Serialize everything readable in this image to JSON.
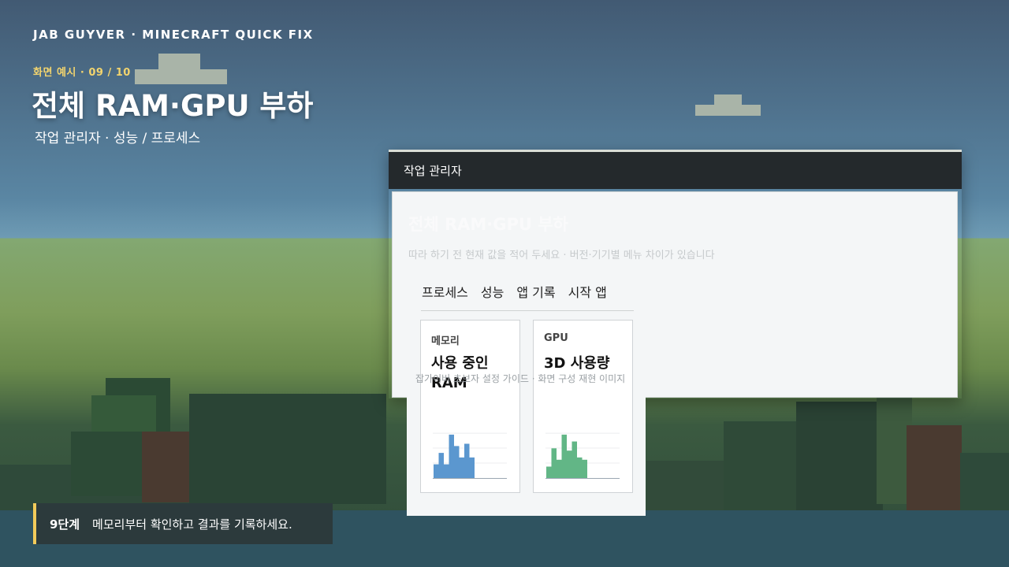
{
  "brand": "JAB GUYVER · MINECRAFT QUICK FIX",
  "kicker": "화면 예시 · 09 / 10",
  "headline": "전체 RAM·GPU 부하",
  "subline": "작업 관리자 · 성능 / 프로세스",
  "window": {
    "title": "작업 관리자",
    "ghost_title": "전체 RAM·GPU 부하",
    "note": "따라 하기 전 현재 값을 적어 두세요 · 버전·기기별 메뉴 차이가 있습니다",
    "tabs": [
      "프로세스",
      "성능",
      "앱 기록",
      "시작 앱"
    ]
  },
  "cards": [
    {
      "category": "메모리",
      "title": "사용 중인 RAM",
      "color": "#5b97cf",
      "values": [
        0.3,
        0.55,
        0.3,
        0.95,
        0.7,
        0.45,
        0.75,
        0.45
      ]
    },
    {
      "category": "GPU",
      "title": "3D 사용량",
      "color": "#62b686",
      "values": [
        0.25,
        0.65,
        0.4,
        0.95,
        0.6,
        0.8,
        0.45,
        0.4
      ]
    }
  ],
  "overlay_text": "잡가이버 초보자 설정 가이드   ·   화면 구성 재현 이미지",
  "step": {
    "number": "9단계",
    "text": "메모리부터 확인하고 결과를 기록하세요."
  },
  "colors": {
    "accent": "#f2cb5a",
    "kicker": "#f2d46e",
    "titlebar": "#24292c"
  }
}
